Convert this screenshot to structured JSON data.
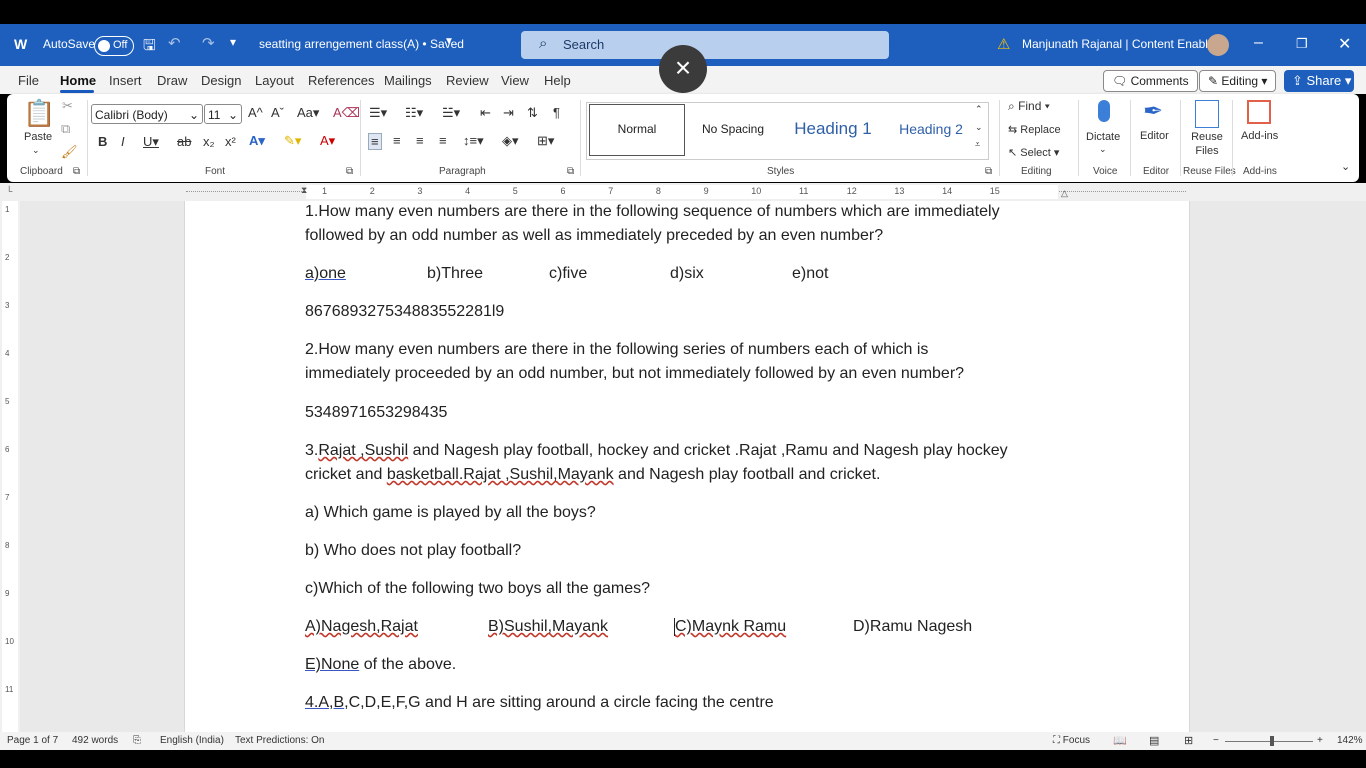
{
  "titlebar": {
    "autosave_label": "AutoSave",
    "autosave_state": "Off",
    "doc_title": "seatting arrengement class(A) • Saved",
    "search_placeholder": "Search",
    "user_name": "Manjunath Rajanal | Content Enablers"
  },
  "tabs": [
    "File",
    "Home",
    "Insert",
    "Draw",
    "Design",
    "Layout",
    "References",
    "Mailings",
    "Review",
    "View",
    "Help"
  ],
  "active_tab": "Home",
  "ribbon_right": {
    "comments": "Comments",
    "editing": "Editing",
    "share": "Share"
  },
  "font": {
    "name": "Calibri (Body)",
    "size": "11"
  },
  "groups": {
    "clipboard": "Clipboard",
    "font": "Font",
    "paragraph": "Paragraph",
    "styles": "Styles",
    "editing": "Editing",
    "voice": "Voice",
    "editor": "Editor",
    "reuse": "Reuse Files",
    "addins": "Add-ins"
  },
  "buttons": {
    "paste": "Paste",
    "find": "Find",
    "replace": "Replace",
    "select": "Select",
    "dictate": "Dictate",
    "editor": "Editor",
    "reuse_files": "Reuse Files",
    "add_ins": "Add-ins"
  },
  "styles_gallery": [
    "Normal",
    "No Spacing",
    "Heading 1",
    "Heading 2"
  ],
  "ruler_numbers": [
    "1",
    "2",
    "3",
    "4",
    "5",
    "6",
    "7",
    "8",
    "9",
    "10",
    "11",
    "12",
    "13",
    "14",
    "15"
  ],
  "vruler_numbers": [
    "1",
    "2",
    "3",
    "4",
    "5",
    "6",
    "7",
    "8",
    "9",
    "10",
    "11"
  ],
  "document": {
    "q1_line1": "1.How many even numbers are there in the following sequence of numbers which are immediately",
    "q1_line2": "followed by an odd number as well as immediately preceded by an even number?",
    "q1_opt_a": "a)one",
    "q1_opt_b": "b)Three",
    "q1_opt_c": "c)five",
    "q1_opt_d": "d)six",
    "q1_opt_e": "e)not",
    "q1_seq": "867689327534883552281l9",
    "q2_line1": "2.How many even numbers are there in the following series of numbers each of which is",
    "q2_line2": "immediately proceeded by an odd number, but not immediately followed by an even number?",
    "q2_seq": "5348971653298435",
    "q3_num": "3.",
    "q3_rajat": "Rajat ,Sushil",
    "q3_rest1": " and Nagesh play football, hockey and cricket .Rajat ,Ramu and Nagesh play hockey",
    "q3_line2a": "cricket and ",
    "q3_basket": "basketball.Rajat ,Sushil,Mayank",
    "q3_line2b": " and Nagesh play football and cricket.",
    "q3_a": "a) Which game is played by all the boys?",
    "q3_b": "b) Who does not play football?",
    "q3_c": "c)Which of the following two boys all the games?",
    "q3_optA": "A)Nagesh,Rajat",
    "q3_optB": "B)Sushil,Mayank",
    "q3_optC": "C)Maynk Ramu",
    "q3_optD": "D)Ramu Nagesh",
    "q3_optE1": "E)None",
    "q3_optE2": " of the above.",
    "q4_a": "4.A,B",
    "q4_b": ",C,D,E,F,G and H are sitting around a circle facing the centre"
  },
  "status": {
    "page": "Page 1 of 7",
    "words": "492 words",
    "language": "English (India)",
    "predictions": "Text Predictions: On",
    "focus": "Focus",
    "zoom": "142%"
  }
}
